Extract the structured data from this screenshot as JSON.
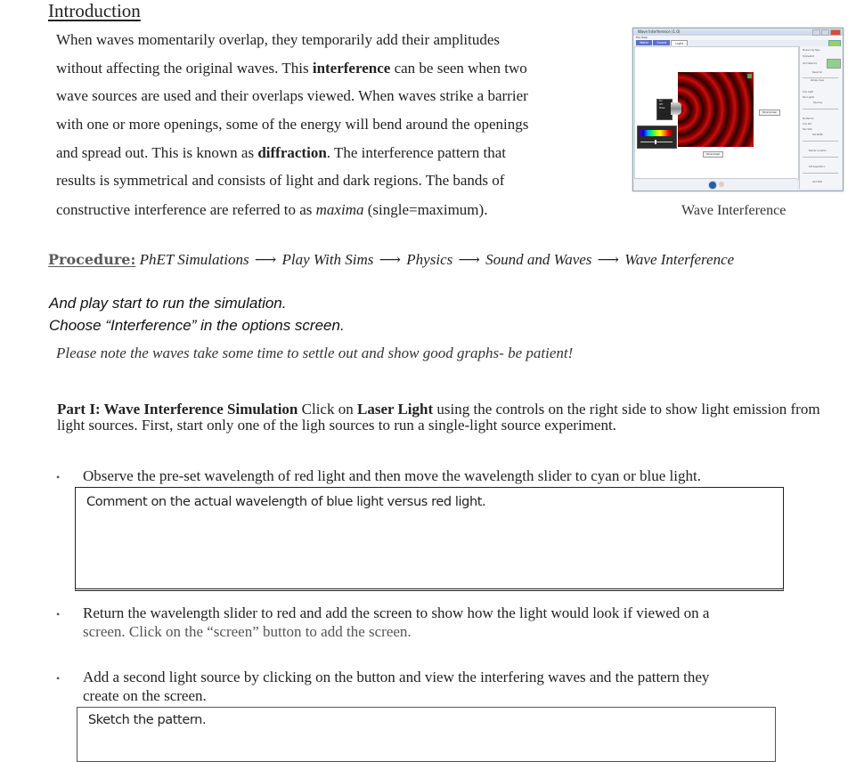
{
  "intro": {
    "heading": "Introduction",
    "lines": [
      [
        {
          "t": "When waves momentarily overlap, they temporarily add their amplitudes"
        }
      ],
      [
        {
          "t": "without affecting the original waves. This "
        },
        {
          "t": "interference",
          "b": true
        },
        {
          "t": " can be seen when two"
        }
      ],
      [
        {
          "t": "wave sources are used and their overlaps viewed. When waves strike a barrier"
        }
      ],
      [
        {
          "t": "with one or more openings, some of the energy will bend around the openings"
        }
      ],
      [
        {
          "t": "and spread out. This is known as "
        },
        {
          "t": "diffraction",
          "b": true
        },
        {
          "t": ".  The interference pattern that"
        }
      ],
      [
        {
          "t": "results is symmetrical and consists of light and dark regions. The bands of"
        }
      ],
      [
        {
          "t": "constructive interference are referred to as "
        },
        {
          "t": "maxima",
          "i": true
        },
        {
          "t": " (single=maximum)."
        }
      ]
    ]
  },
  "sim_image": {
    "window_title": "Wave Interference (1.0)",
    "menu": "File  Help",
    "tabs": [
      "Water",
      "Sound",
      "Light"
    ],
    "active_tab": "Light",
    "emitter_options": [
      "On",
      "Off"
    ],
    "emitter_button": "Pulse",
    "screen_button": "Show Screen",
    "graph_button": "Show Graph",
    "controls": [
      "Measuring Tape",
      "Stopwatch",
      "Add Detector",
      "Reset All",
      "Rotate View",
      "One Light",
      "Two Lights",
      "Spacing",
      "No Barrier",
      "One Slit",
      "Two Slits",
      "Slit Width",
      "Barrier Location",
      "Slit Separation",
      "Add Wall"
    ],
    "caption": "Wave Interference"
  },
  "procedure": {
    "label": "Procedure:",
    "steps": [
      "PhET Simulations",
      "Play With Sims",
      "Physics",
      "Sound and Waves",
      "Wave Interference"
    ],
    "arrow": "⟶"
  },
  "instructions": {
    "play": "And play start to run the simulation.",
    "choose": "Choose “Interference” in the options screen.",
    "note": "Please note the waves take some time to settle out and show good graphs- be  patient!"
  },
  "part1": {
    "title": "Part I: Wave Interference Simulation",
    "pre_bold": " Click on ",
    "bold2": "Laser Light",
    "rest": " using the controls on the right side to show light emission from light sources. First, start only one of the ligh sources to run a single-light source experiment."
  },
  "bullets": [
    {
      "line1": "Observe the pre-set wavelength of red light and then move the wavelength slider to cyan or blue light."
    },
    {
      "line1": "Return the wavelength slider to red and add the screen to show how the light would look if viewed on a",
      "line2": "screen. Click on the “screen” button to add the screen."
    },
    {
      "line1": "Add a second light source by clicking on the button and view the interfering waves and the pattern they",
      "line2": "create on the  screen."
    }
  ],
  "bullet_glyph": "•",
  "answer_boxes": [
    {
      "prompt": "Comment on the actual wavelength of blue light versus red light."
    },
    {
      "prompt": "Sketch the pattern."
    }
  ]
}
